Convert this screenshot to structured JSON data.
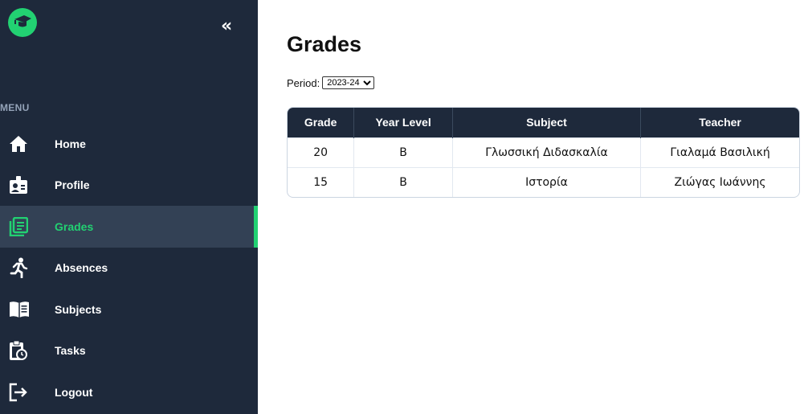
{
  "sidebar": {
    "collapse_glyph": "«",
    "menu_label": "MENU",
    "items": [
      {
        "label": "Home",
        "icon": "home-icon"
      },
      {
        "label": "Profile",
        "icon": "profile-badge-icon"
      },
      {
        "label": "Grades",
        "icon": "grades-list-icon",
        "active": true
      },
      {
        "label": "Absences",
        "icon": "running-person-icon"
      },
      {
        "label": "Subjects",
        "icon": "open-book-icon"
      },
      {
        "label": "Tasks",
        "icon": "clipboard-clock-icon"
      },
      {
        "label": "Logout",
        "icon": "logout-icon"
      }
    ]
  },
  "main": {
    "title": "Grades",
    "period_label": "Period:",
    "period_selected": "2023-24",
    "table": {
      "headers": [
        "Grade",
        "Year Level",
        "Subject",
        "Teacher"
      ],
      "rows": [
        [
          "20",
          "B",
          "Γλωσσική Διδασκαλία",
          "Γιαλαμά Βασιλική"
        ],
        [
          "15",
          "B",
          "Ιστορία",
          "Ζιώγας Ιωάννης"
        ]
      ]
    }
  },
  "colors": {
    "sidebar_bg": "#1e293b",
    "accent": "#22d172",
    "active_bg": "#334155"
  }
}
